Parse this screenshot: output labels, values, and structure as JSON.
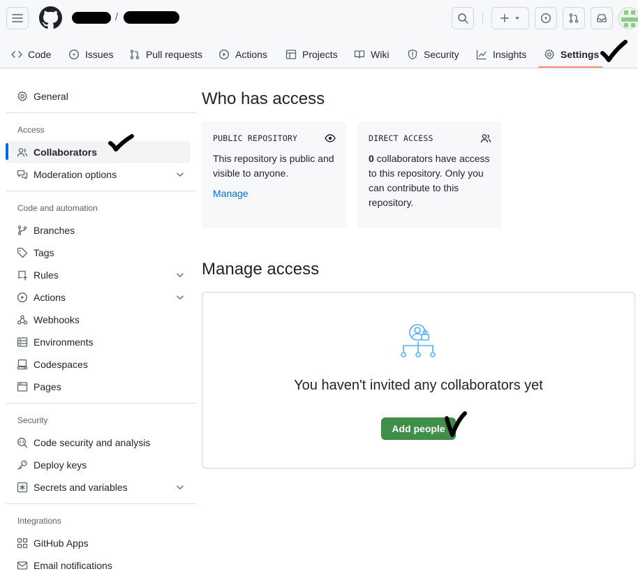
{
  "header": {
    "repo_separator": "/",
    "icons": [
      "hamburger-icon",
      "github-logo",
      "search-icon",
      "plus-icon",
      "issue-icon",
      "pull-request-icon",
      "inbox-icon"
    ]
  },
  "tabs": [
    {
      "label": "Code",
      "icon": "code-icon"
    },
    {
      "label": "Issues",
      "icon": "issue-icon"
    },
    {
      "label": "Pull requests",
      "icon": "pull-request-icon"
    },
    {
      "label": "Actions",
      "icon": "play-icon"
    },
    {
      "label": "Projects",
      "icon": "table-icon"
    },
    {
      "label": "Wiki",
      "icon": "book-icon"
    },
    {
      "label": "Security",
      "icon": "shield-icon"
    },
    {
      "label": "Insights",
      "icon": "graph-icon"
    },
    {
      "label": "Settings",
      "icon": "gear-icon",
      "selected": true
    }
  ],
  "sidebar": {
    "general": "General",
    "sections": [
      {
        "heading": "Access",
        "items": [
          "Collaborators",
          "Moderation options"
        ]
      },
      {
        "heading": "Code and automation",
        "items": [
          "Branches",
          "Tags",
          "Rules",
          "Actions",
          "Webhooks",
          "Environments",
          "Codespaces",
          "Pages"
        ]
      },
      {
        "heading": "Security",
        "items": [
          "Code security and analysis",
          "Deploy keys",
          "Secrets and variables"
        ]
      },
      {
        "heading": "Integrations",
        "items": [
          "GitHub Apps",
          "Email notifications"
        ]
      }
    ],
    "active_item": "Collaborators"
  },
  "main": {
    "who_has_access_title": "Who has access",
    "public_card": {
      "title": "PUBLIC REPOSITORY",
      "text": "This repository is public and visible to anyone.",
      "link": "Manage"
    },
    "direct_card": {
      "title": "DIRECT ACCESS",
      "count": "0",
      "text": " collaborators have access to this repository. Only you can contribute to this repository."
    },
    "manage_access_title": "Manage access",
    "empty_title": "You haven't invited any collaborators yet",
    "add_button": "Add people"
  },
  "colors": {
    "accent": "#0969da",
    "tab_underline": "#fd8c73",
    "primary_button": "#3f8f49",
    "illustration": "#54aeff"
  }
}
